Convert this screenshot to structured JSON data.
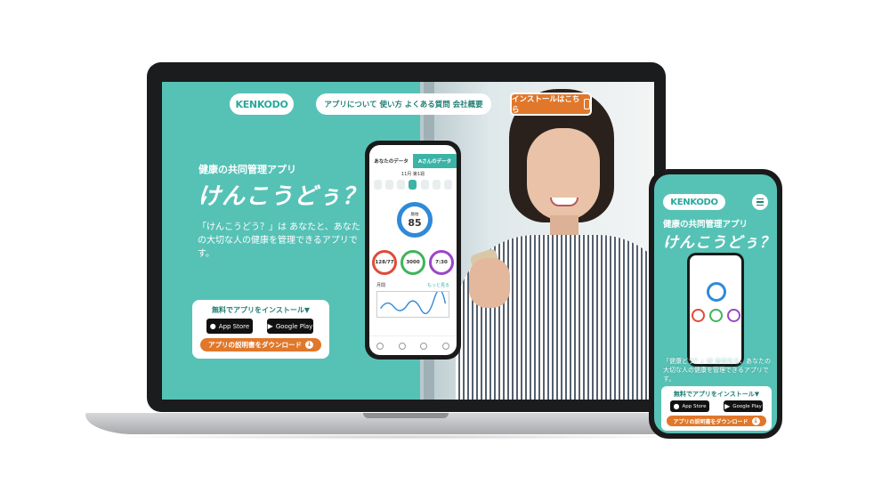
{
  "brand": {
    "logo_text": "KENKODO",
    "accent": "#56c2b6",
    "orange": "#e0772a"
  },
  "nav": {
    "items": [
      "アプリについて",
      "使い方",
      "よくある質問",
      "会社概要"
    ],
    "install_label": "インストールはこちら"
  },
  "hero": {
    "eyebrow": "健康の共同管理アプリ",
    "title": "けんこうどぅ？",
    "description": "「けんこうどう？」は あなたと、あなたの大切な人の健康を管理できるアプリです。"
  },
  "cta": {
    "label": "無料でアプリをインストール▼",
    "app_store": "App Store",
    "google_play": "Google Play",
    "download_label": "アプリの説明書をダウンロード"
  },
  "mock_app": {
    "tab_mine": "あなたのデータ",
    "tab_other": "Aさんのデータ",
    "week_label": "11月 第1週",
    "pulse_label": "脈拍",
    "pulse_value": "85",
    "bp_value": "128/77",
    "steps_value": "3000",
    "sleep_value": "7:30",
    "graph_label": "月間",
    "graph_link": "もっと見る"
  },
  "phone": {
    "description": "「健康どう？」は あなたと、あなたの大切な人の健康を管理できるアプリです。"
  }
}
